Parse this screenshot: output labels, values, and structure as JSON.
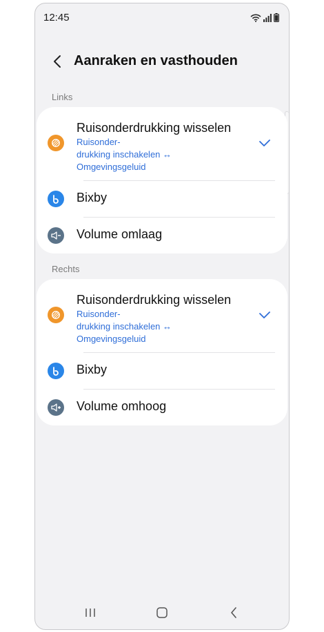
{
  "status_bar": {
    "time": "12:45",
    "icons": [
      "wifi-icon",
      "signal-icon",
      "battery-icon"
    ]
  },
  "header": {
    "title": "Aanraken en vasthouden",
    "back_icon": "chevron-left-icon"
  },
  "sections": [
    {
      "label": "Links",
      "items": [
        {
          "title": "Ruisonderdrukking wisselen",
          "subtitle_lines": [
            "Ruisonder-",
            "drukking inschakelen ↔",
            "Omgevingsgeluid"
          ],
          "icon": "noise-control-icon",
          "icon_color": "#f0962b",
          "selected": true
        },
        {
          "title": "Bixby",
          "icon": "bixby-icon",
          "icon_color": "#2a86e8",
          "selected": false
        },
        {
          "title": "Volume omlaag",
          "icon": "volume-down-icon",
          "icon_color": "#5b7389",
          "selected": false
        }
      ]
    },
    {
      "label": "Rechts",
      "items": [
        {
          "title": "Ruisonderdrukking wisselen",
          "subtitle_lines": [
            "Ruisonder-",
            "drukking inschakelen ↔",
            "Omgevingsgeluid"
          ],
          "icon": "noise-control-icon",
          "icon_color": "#f0962b",
          "selected": true
        },
        {
          "title": "Bixby",
          "icon": "bixby-icon",
          "icon_color": "#2a86e8",
          "selected": false
        },
        {
          "title": "Volume omhoog",
          "icon": "volume-up-icon",
          "icon_color": "#5b7389",
          "selected": false
        }
      ]
    }
  ],
  "nav_bar": {
    "icons": [
      "recent-apps-icon",
      "home-icon",
      "back-icon"
    ]
  },
  "colors": {
    "accent": "#2f6ed8",
    "background": "#f2f2f4",
    "card": "#ffffff"
  }
}
